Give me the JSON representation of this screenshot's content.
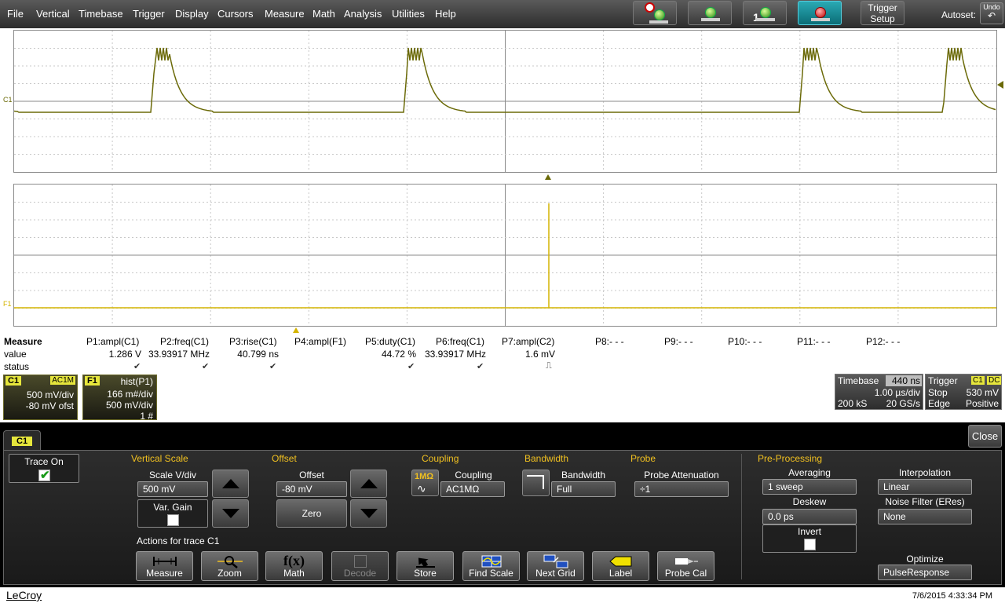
{
  "menu": [
    "File",
    "Vertical",
    "Timebase",
    "Trigger",
    "Display",
    "Cursors",
    "Measure",
    "Math",
    "Analysis",
    "Utilities",
    "Help"
  ],
  "toolbar": {
    "trigger_setup_line1": "Trigger",
    "trigger_setup_line2": "Setup",
    "autoset_label": "Autoset:",
    "undo_label": "Undo",
    "single_badge": "1"
  },
  "grid_labels": {
    "c1": "C1",
    "f1": "F1"
  },
  "measure": {
    "row_labels": {
      "title": "Measure",
      "value": "value",
      "status": "status"
    },
    "params": [
      {
        "name": "P1:ampl(C1)",
        "value": "1.286 V",
        "status": "✔"
      },
      {
        "name": "P2:freq(C1)",
        "value": "33.93917 MHz",
        "status": "✔"
      },
      {
        "name": "P3:rise(C1)",
        "value": "40.799 ns",
        "status": "✔"
      },
      {
        "name": "P4:ampl(F1)",
        "value": "",
        "status": ""
      },
      {
        "name": "P5:duty(C1)",
        "value": "44.72 %",
        "status": "✔"
      },
      {
        "name": "P6:freq(C1)",
        "value": "33.93917 MHz",
        "status": "✔"
      },
      {
        "name": "P7:ampl(C2)",
        "value": "1.6 mV",
        "status": "⎍"
      },
      {
        "name": "P8:- - -",
        "value": "",
        "status": ""
      },
      {
        "name": "P9:- - -",
        "value": "",
        "status": ""
      },
      {
        "name": "P10:- - -",
        "value": "",
        "status": ""
      },
      {
        "name": "P11:- - -",
        "value": "",
        "status": ""
      },
      {
        "name": "P12:- - -",
        "value": "",
        "status": ""
      }
    ]
  },
  "channel_c1": {
    "tag": "C1",
    "coupling": "AC1M",
    "scale": "500 mV/div",
    "offset": "-80 mV ofst"
  },
  "channel_f1": {
    "tag": "F1",
    "function": "hist(P1)",
    "scale1": "166 m#/div",
    "scale2": "500 mV/div",
    "count": "1 #"
  },
  "timebase": {
    "label": "Timebase",
    "delay": "440 ns",
    "per_div": "1.00 µs/div",
    "samples": "200 kS",
    "rate": "20 GS/s"
  },
  "trigger": {
    "label": "Trigger",
    "src": "C1",
    "coupling": "DC",
    "mode": "Stop",
    "level": "530 mV",
    "type": "Edge",
    "slope": "Positive"
  },
  "panel": {
    "tab": "C1",
    "close": "Close",
    "trace_on": "Trace On",
    "vertical_scale": "Vertical Scale",
    "scale_label": "Scale V/div",
    "scale_value": "500 mV",
    "var_gain": "Var. Gain",
    "offset_section": "Offset",
    "offset_label": "Offset",
    "offset_value": "-80 mV",
    "zero": "Zero",
    "coupling_section": "Coupling",
    "coupling_label": "Coupling",
    "coupling_value": "AC1MΩ",
    "coupling_icon": "1MΩ",
    "bandwidth_section": "Bandwidth",
    "bandwidth_label": "Bandwidth",
    "bandwidth_value": "Full",
    "probe_section": "Probe",
    "probe_label": "Probe Attenuation",
    "probe_value": "÷1",
    "preproc": "Pre-Processing",
    "averaging_label": "Averaging",
    "averaging_value": "1 sweep",
    "interp_label": "Interpolation",
    "interp_value": "Linear",
    "deskew_label": "Deskew",
    "deskew_value": "0.0 ps",
    "noise_label": "Noise Filter (ERes)",
    "noise_value": "None",
    "invert_label": "Invert",
    "optimize_label": "Optimize",
    "optimize_value": "PulseResponse",
    "actions_label": "Actions for trace C1",
    "actions": [
      "Measure",
      "Zoom",
      "Math",
      "Decode",
      "Store",
      "Find Scale",
      "Next Grid",
      "Label",
      "Probe Cal"
    ]
  },
  "footer": {
    "brand": "LeCroy",
    "datetime": "7/6/2015 4:33:34 PM"
  },
  "colors": {
    "trace": "#6b6a08",
    "f1_trace": "#d4b400",
    "section": "#f0c020"
  }
}
